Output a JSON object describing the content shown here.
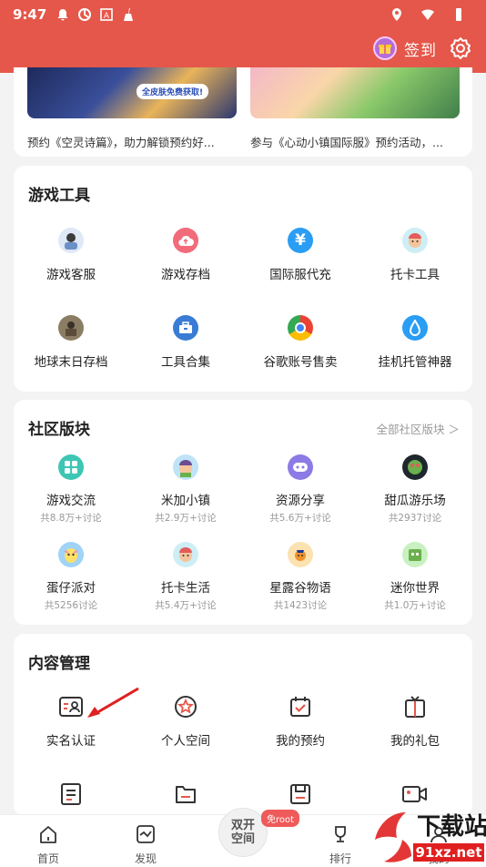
{
  "status_bar": {
    "time": "9:47"
  },
  "header": {
    "checkin_label": "签到"
  },
  "promo": {
    "left_tag": "全皮肤免费获取!",
    "left_caption": "预约《空灵诗篇》，助力解锁预约好...",
    "right_caption": "参与《心动小镇国际服》预约活动，..."
  },
  "tools": {
    "title": "游戏工具",
    "items": [
      {
        "label": "游戏客服",
        "icon": "customer-service-avatar-icon",
        "color": "#6b8fc7"
      },
      {
        "label": "游戏存档",
        "icon": "cloud-upload-icon",
        "color": "#f26b7a"
      },
      {
        "label": "国际服代充",
        "icon": "yen-icon",
        "color": "#2a9df4"
      },
      {
        "label": "托卡工具",
        "icon": "toca-character-icon",
        "color": "#4fb3c8"
      },
      {
        "label": "地球末日存档",
        "icon": "soldier-avatar-icon",
        "color": "#7a6a52"
      },
      {
        "label": "工具合集",
        "icon": "toolbox-icon",
        "color": "#3a7bd5"
      },
      {
        "label": "谷歌账号售卖",
        "icon": "chrome-icon",
        "color": "#4285f4"
      },
      {
        "label": "挂机托管神器",
        "icon": "water-drop-icon",
        "color": "#2a9df4"
      }
    ]
  },
  "community": {
    "title": "社区版块",
    "all_link": "全部社区版块 ＞",
    "items": [
      {
        "label": "游戏交流",
        "sub": "共8.8万+讨论",
        "icon": "grid-apps-icon",
        "color": "#3ec6b4"
      },
      {
        "label": "米加小镇",
        "sub": "共2.9万+讨论",
        "icon": "miga-town-icon",
        "color": "#6ab04c"
      },
      {
        "label": "资源分享",
        "sub": "共5.6万+讨论",
        "icon": "gamepad-icon",
        "color": "#8c7ae6"
      },
      {
        "label": "甜瓜游乐场",
        "sub": "共2937讨论",
        "icon": "melon-playground-icon",
        "color": "#2d3436"
      },
      {
        "label": "蛋仔派对",
        "sub": "共5256讨论",
        "icon": "eggy-party-icon",
        "color": "#f9a8d4"
      },
      {
        "label": "托卡生活",
        "sub": "共5.4万+讨论",
        "icon": "toca-life-icon",
        "color": "#4fb3c8"
      },
      {
        "label": "星露谷物语",
        "sub": "共1423讨论",
        "icon": "stardew-valley-icon",
        "color": "#f0932b"
      },
      {
        "label": "迷你世界",
        "sub": "共1.0万+讨论",
        "icon": "mini-world-icon",
        "color": "#6ab04c"
      }
    ]
  },
  "content": {
    "title": "内容管理",
    "items": [
      {
        "label": "实名认证",
        "icon": "id-card-icon"
      },
      {
        "label": "个人空间",
        "icon": "star-badge-icon"
      },
      {
        "label": "我的预约",
        "icon": "calendar-check-icon"
      },
      {
        "label": "我的礼包",
        "icon": "gift-box-icon"
      },
      {
        "label": "",
        "icon": "document-list-icon"
      },
      {
        "label": "",
        "icon": "folder-icon"
      },
      {
        "label": "",
        "icon": "save-icon"
      },
      {
        "label": "",
        "icon": "video-camera-icon"
      }
    ],
    "accent": "#e5574a"
  },
  "bottom_nav": {
    "home": "首页",
    "discover": "发现",
    "center": "双开\n空间",
    "center_top": "双开",
    "center_bottom": "空间",
    "badge": "免root",
    "rank": "排行",
    "mine": "我的"
  },
  "watermark": {
    "text": "下载站",
    "url_text": "91xz.net"
  }
}
